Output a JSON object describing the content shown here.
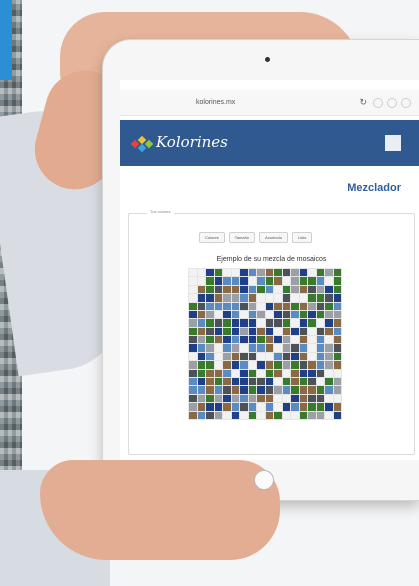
{
  "browser": {
    "url": "kolorines.mx"
  },
  "site": {
    "brand": "Kolorines",
    "page_title": "Mezclador"
  },
  "mixer": {
    "panel_legend": "Tus colores",
    "buttons": [
      "Colores",
      "Tamaño",
      "Acomodo",
      "Listo"
    ],
    "preview_caption": "Ejemplo de su mezcla de mosaicos"
  },
  "colors": {
    "header_blue": "#305a8f",
    "title_blue": "#2f5f98",
    "tile_palette": [
      "#1f3f86",
      "#3a7a2d",
      "#8a6a44",
      "#f2f2f2",
      "#9aa0a6",
      "#4c5258",
      "#5a8bc1"
    ]
  },
  "mosaic": {
    "columns": 18,
    "rows": 18
  }
}
